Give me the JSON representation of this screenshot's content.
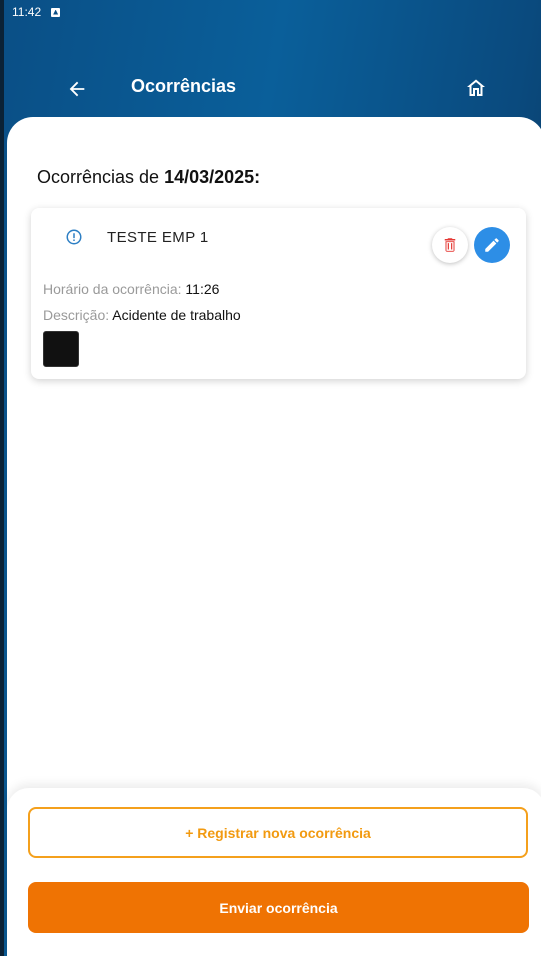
{
  "status_bar": {
    "time": "11:42",
    "notification_icon": "a-icon"
  },
  "header": {
    "title": "Ocorrências",
    "back_icon": "arrow-left-icon",
    "home_icon": "home-icon"
  },
  "main": {
    "heading_prefix": "Ocorrências de ",
    "heading_date": "14/03/2025:"
  },
  "occurrence": {
    "title": "TESTE EMP 1",
    "time_label": "Horário da ocorrência: ",
    "time_value": "11:26",
    "description_label": "Descrição: ",
    "description_value": "Acidente de trabalho"
  },
  "footer": {
    "new_button": "+ Registrar nova ocorrência",
    "send_button": "Enviar ocorrência"
  },
  "colors": {
    "header_blue": "#0a5f9a",
    "accent_orange": "#ef7303",
    "outline_orange": "#f4a01c",
    "edit_blue": "#2d8ee6",
    "delete_red": "#e53935"
  }
}
